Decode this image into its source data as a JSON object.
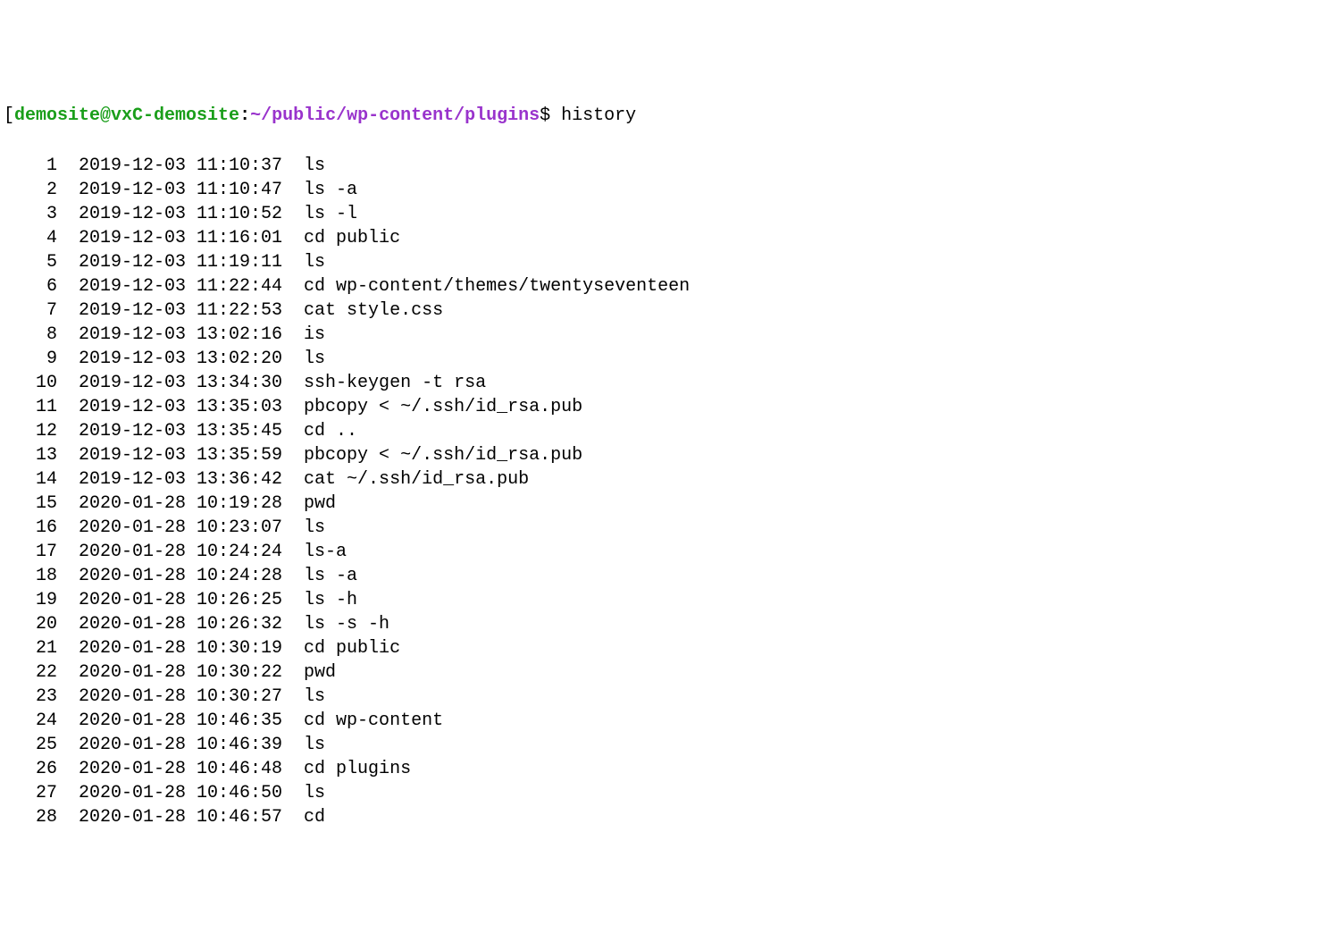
{
  "prompt": {
    "bracket_open": "[",
    "user_host": "demosite@vxC-demosite",
    "colon": ":",
    "path": "~/public/wp-content/plugins",
    "dollar": "$",
    "command": "history"
  },
  "history": [
    {
      "num": "1",
      "ts": "2019-12-03 11:10:37",
      "cmd": "ls"
    },
    {
      "num": "2",
      "ts": "2019-12-03 11:10:47",
      "cmd": "ls -a"
    },
    {
      "num": "3",
      "ts": "2019-12-03 11:10:52",
      "cmd": "ls -l"
    },
    {
      "num": "4",
      "ts": "2019-12-03 11:16:01",
      "cmd": "cd public"
    },
    {
      "num": "5",
      "ts": "2019-12-03 11:19:11",
      "cmd": "ls"
    },
    {
      "num": "6",
      "ts": "2019-12-03 11:22:44",
      "cmd": "cd wp-content/themes/twentyseventeen"
    },
    {
      "num": "7",
      "ts": "2019-12-03 11:22:53",
      "cmd": "cat style.css"
    },
    {
      "num": "8",
      "ts": "2019-12-03 13:02:16",
      "cmd": "is"
    },
    {
      "num": "9",
      "ts": "2019-12-03 13:02:20",
      "cmd": "ls"
    },
    {
      "num": "10",
      "ts": "2019-12-03 13:34:30",
      "cmd": "ssh-keygen -t rsa"
    },
    {
      "num": "11",
      "ts": "2019-12-03 13:35:03",
      "cmd": "pbcopy < ~/.ssh/id_rsa.pub"
    },
    {
      "num": "12",
      "ts": "2019-12-03 13:35:45",
      "cmd": "cd .."
    },
    {
      "num": "13",
      "ts": "2019-12-03 13:35:59",
      "cmd": "pbcopy < ~/.ssh/id_rsa.pub"
    },
    {
      "num": "14",
      "ts": "2019-12-03 13:36:42",
      "cmd": "cat ~/.ssh/id_rsa.pub"
    },
    {
      "num": "15",
      "ts": "2020-01-28 10:19:28",
      "cmd": "pwd"
    },
    {
      "num": "16",
      "ts": "2020-01-28 10:23:07",
      "cmd": "ls"
    },
    {
      "num": "17",
      "ts": "2020-01-28 10:24:24",
      "cmd": "ls-a"
    },
    {
      "num": "18",
      "ts": "2020-01-28 10:24:28",
      "cmd": "ls -a"
    },
    {
      "num": "19",
      "ts": "2020-01-28 10:26:25",
      "cmd": "ls -h"
    },
    {
      "num": "20",
      "ts": "2020-01-28 10:26:32",
      "cmd": "ls -s -h"
    },
    {
      "num": "21",
      "ts": "2020-01-28 10:30:19",
      "cmd": "cd public"
    },
    {
      "num": "22",
      "ts": "2020-01-28 10:30:22",
      "cmd": "pwd"
    },
    {
      "num": "23",
      "ts": "2020-01-28 10:30:27",
      "cmd": "ls"
    },
    {
      "num": "24",
      "ts": "2020-01-28 10:46:35",
      "cmd": "cd wp-content"
    },
    {
      "num": "25",
      "ts": "2020-01-28 10:46:39",
      "cmd": "ls"
    },
    {
      "num": "26",
      "ts": "2020-01-28 10:46:48",
      "cmd": "cd plugins"
    },
    {
      "num": "27",
      "ts": "2020-01-28 10:46:50",
      "cmd": "ls"
    },
    {
      "num": "28",
      "ts": "2020-01-28 10:46:57",
      "cmd": "cd"
    }
  ]
}
